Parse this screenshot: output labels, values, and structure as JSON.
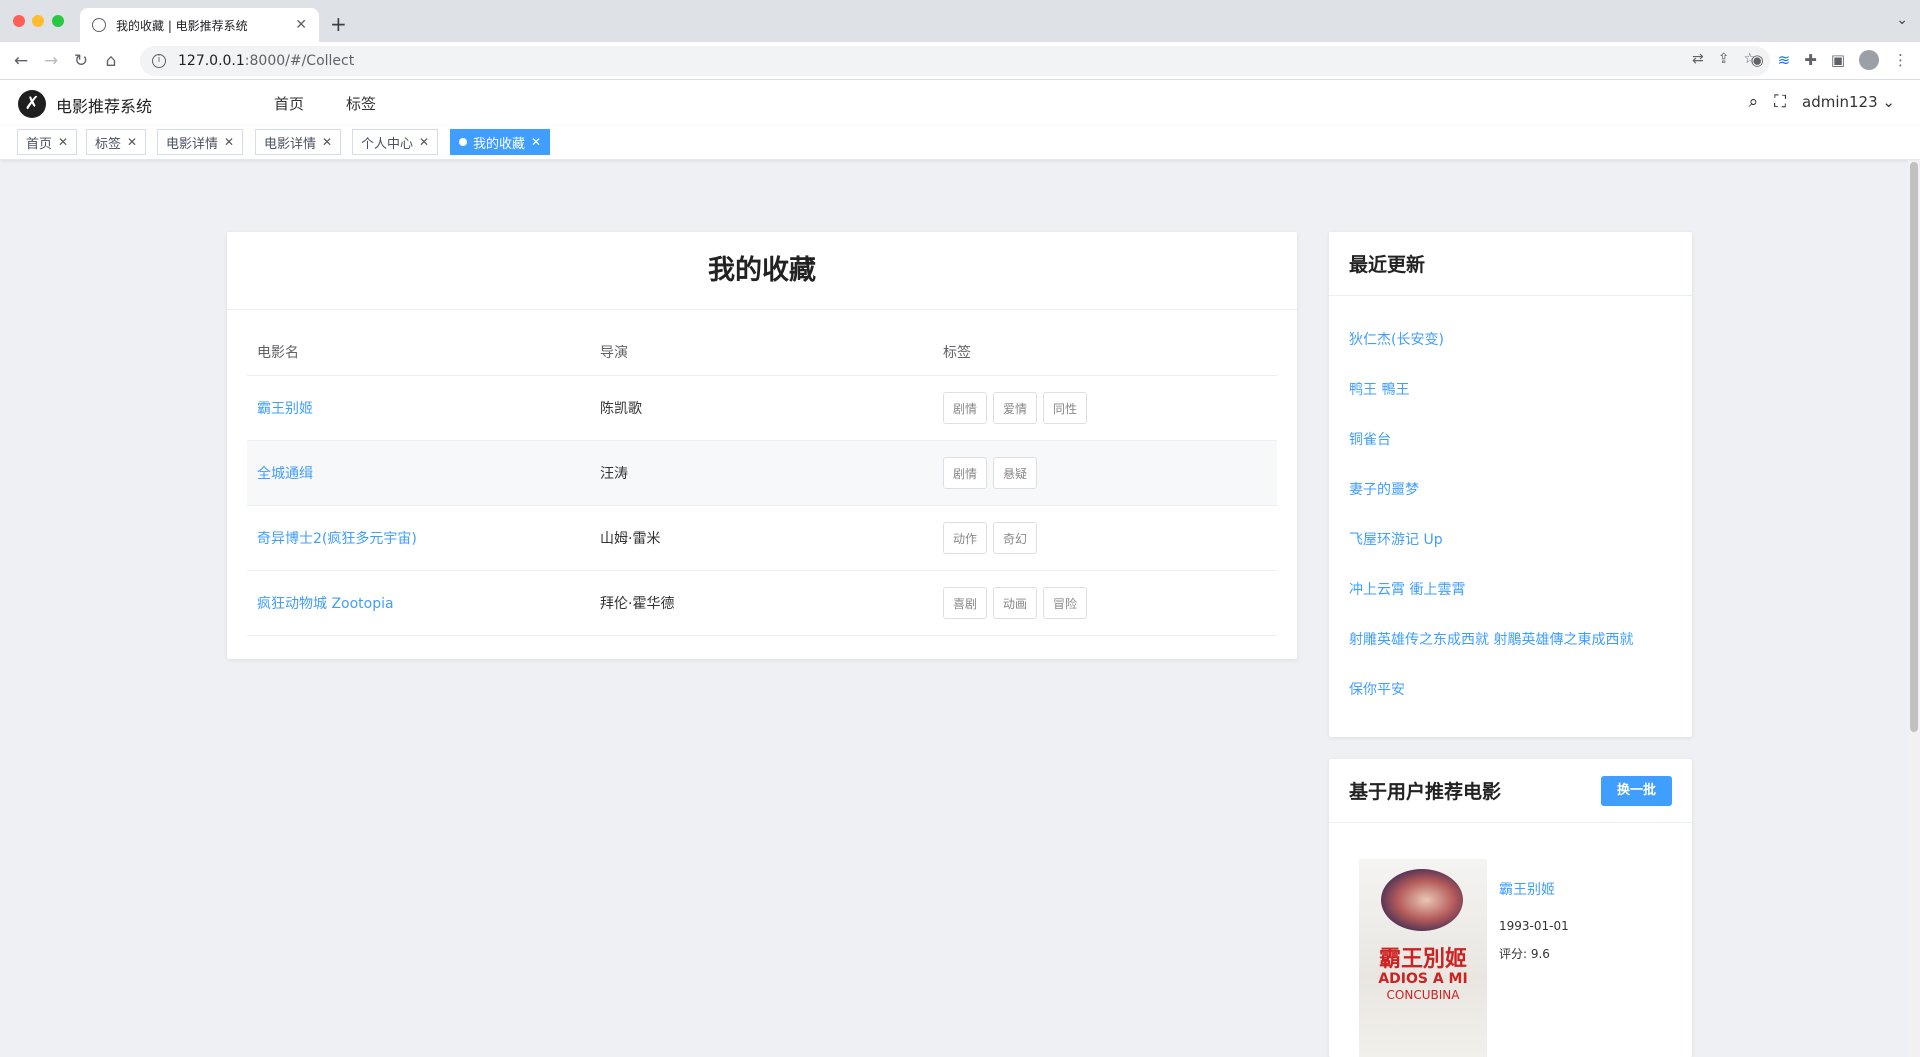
{
  "browser": {
    "tab_title": "我的收藏 | 电影推荐系统",
    "url_host": "127.0.0.1",
    "url_rest": ":8000/#/Collect"
  },
  "header": {
    "brand": "电影推荐系统",
    "nav": [
      "首页",
      "标签"
    ],
    "user": "admin123"
  },
  "tagsbar": {
    "tags": [
      {
        "label": "首页",
        "active": false
      },
      {
        "label": "标签",
        "active": false
      },
      {
        "label": "电影详情",
        "active": false
      },
      {
        "label": "电影详情",
        "active": false
      },
      {
        "label": "个人中心",
        "active": false
      },
      {
        "label": "我的收藏",
        "active": true
      }
    ]
  },
  "collect": {
    "title": "我的收藏",
    "columns": [
      "电影名",
      "导演",
      "标签"
    ],
    "rows": [
      {
        "name": "霸王别姬",
        "director": "陈凯歌",
        "tags": [
          "剧情",
          "爱情",
          "同性"
        ]
      },
      {
        "name": "全城通缉",
        "director": "汪涛",
        "tags": [
          "剧情",
          "悬疑"
        ]
      },
      {
        "name": "奇异博士2(疯狂多元宇宙)",
        "director": "山姆·雷米",
        "tags": [
          "动作",
          "奇幻"
        ]
      },
      {
        "name": "疯狂动物城 Zootopia",
        "director": "拜伦·霍华德",
        "tags": [
          "喜剧",
          "动画",
          "冒险"
        ]
      }
    ]
  },
  "recent": {
    "title": "最近更新",
    "items": [
      "狄仁杰(长安变)",
      "鸭王 鴨王",
      "铜雀台",
      "妻子的噩梦",
      "飞屋环游记 Up",
      "冲上云霄 衝上雲霄",
      "射雕英雄传之东成西就 射鵰英雄傳之東成西就",
      "保你平安"
    ]
  },
  "recommend": {
    "title": "基于用户推荐电影",
    "refresh_label": "换一批",
    "movie_name": "霸王别姬",
    "release_date": "1993-01-01",
    "score": "评分: 9.6",
    "poster_cn": "霸王別姬",
    "poster_en_1": "ADIOS A MI",
    "poster_en_2": "CONCUBINA"
  },
  "colors": {
    "accent": "#409eff",
    "background": "#eef0f3"
  }
}
